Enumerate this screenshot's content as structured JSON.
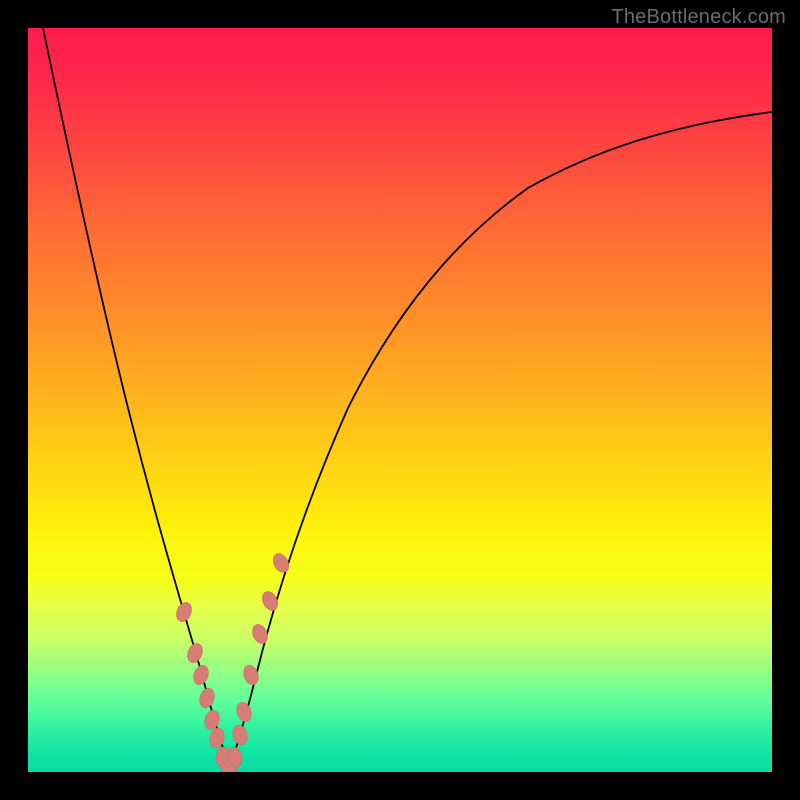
{
  "watermark": "TheBottleneck.com",
  "colors": {
    "frame": "#000000",
    "curve": "#000000",
    "marker_fill": "#d87c76",
    "marker_stroke": "#c26a64",
    "gradient_top": "#ff1a4d",
    "gradient_bottom": "#0adca6"
  },
  "chart_data": {
    "type": "line",
    "title": "",
    "xlabel": "",
    "ylabel": "",
    "xlim": [
      0,
      100
    ],
    "ylim": [
      0,
      100
    ],
    "grid": false,
    "legend": false,
    "description": "Bottleneck percentage curve (V-shaped) over a red-to-green vertical gradient. The minimum of the curve touches the bottom (≈0% bottleneck) near x≈27.",
    "series": [
      {
        "name": "bottleneck_curve",
        "x": [
          2,
          5,
          8,
          11,
          14,
          17,
          20,
          22,
          24,
          25,
          26,
          27,
          28,
          29,
          30,
          32,
          35,
          40,
          47,
          55,
          65,
          75,
          85,
          95,
          100
        ],
        "y": [
          100,
          87,
          73,
          59,
          46,
          34,
          23,
          16,
          9,
          5,
          2,
          0,
          2,
          5,
          10,
          18,
          28,
          40,
          52,
          62,
          70,
          76,
          80,
          83,
          85
        ]
      }
    ],
    "markers": {
      "name": "highlighted_points",
      "x": [
        21.0,
        22.5,
        23.3,
        24.0,
        24.7,
        25.4,
        26.2,
        27.0,
        27.8,
        28.5,
        29.0,
        30.0,
        31.2,
        32.5,
        34.0
      ],
      "y": [
        21.5,
        16.0,
        13.0,
        10.0,
        7.0,
        4.5,
        2.0,
        0.5,
        2.0,
        5.0,
        8.0,
        13.0,
        18.5,
        23.0,
        28.0
      ]
    }
  }
}
